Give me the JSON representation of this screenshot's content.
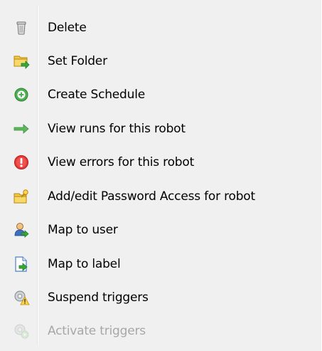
{
  "menu": {
    "items": [
      {
        "label": "Delete",
        "icon": "trash-can-icon",
        "enabled": true
      },
      {
        "label": "Set Folder",
        "icon": "folder-arrow-icon",
        "enabled": true
      },
      {
        "label": "Create Schedule",
        "icon": "green-plus-circle-icon",
        "enabled": true
      },
      {
        "label": "View runs for this robot",
        "icon": "green-arrow-right-icon",
        "enabled": true
      },
      {
        "label": "View errors for this robot",
        "icon": "red-error-circle-icon",
        "enabled": true
      },
      {
        "label": "Add/edit Password Access for robot",
        "icon": "folder-key-icon",
        "enabled": true
      },
      {
        "label": "Map to user",
        "icon": "user-arrow-icon",
        "enabled": true
      },
      {
        "label": "Map to label",
        "icon": "document-arrow-icon",
        "enabled": true
      },
      {
        "label": "Suspend triggers",
        "icon": "gear-warning-icon",
        "enabled": true
      },
      {
        "label": "Activate triggers",
        "icon": "gear-play-icon",
        "enabled": false
      }
    ]
  }
}
